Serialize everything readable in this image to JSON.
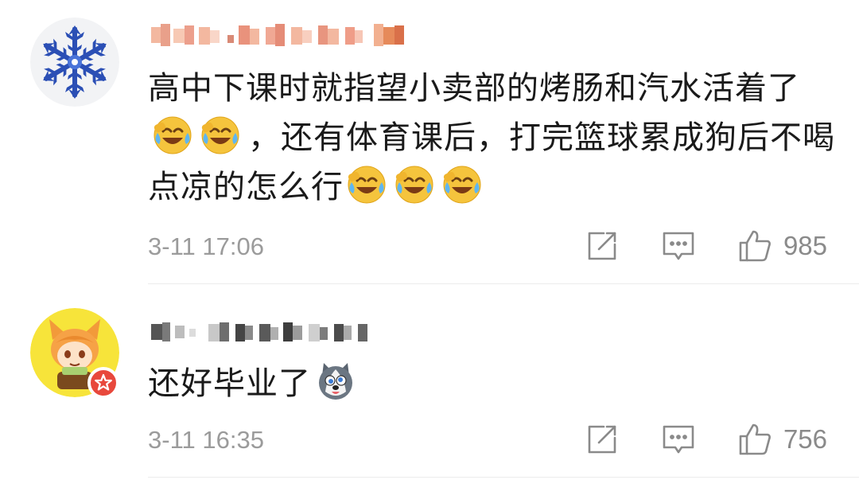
{
  "comments": [
    {
      "text": "高中下课时就指望小卖部的烤肠和汽水活着了",
      "text_after_emoji": "，还有体育课后，打完篮球累成狗后不喝点凉的怎么行",
      "time": "3-11 17:06",
      "likes": "985",
      "avatar_icon": "snowflake-avatar",
      "emoji_icon": "laughing-crying-emoji"
    },
    {
      "text": "还好毕业了",
      "time": "3-11 16:35",
      "likes": "756",
      "avatar_icon": "cartoon-cat-girl-avatar",
      "emoji_icon": "husky-dog-emoji"
    }
  ],
  "colors": {
    "text": "#1a1a1a",
    "meta": "#9b9b9b",
    "icon": "#8a8a8a",
    "badge": "#e8483c",
    "emoji_face": "#f5c43d"
  }
}
